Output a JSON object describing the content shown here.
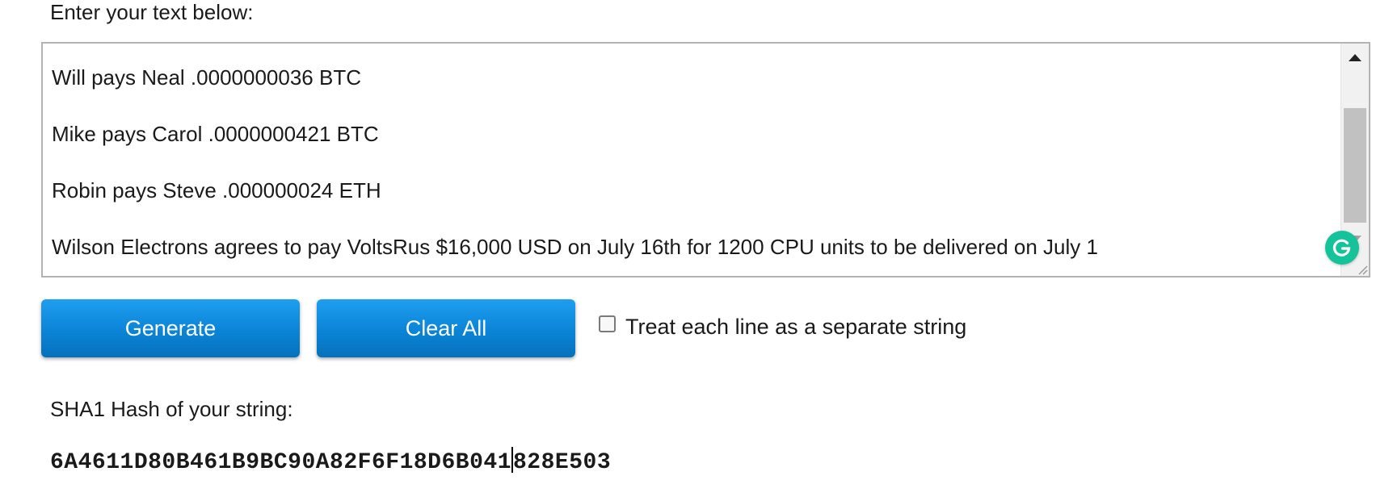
{
  "prompt_label": "Enter your text below:",
  "textarea": {
    "lines": [
      "Will pays Neal .0000000036 BTC",
      "Mike pays Carol .0000000421 BTC",
      "Robin pays Steve .000000024 ETH",
      "Wilson Electrons agrees to pay VoltsRus $16,000 USD on July 16th for 1200 CPU units to be delivered on July 1"
    ]
  },
  "buttons": {
    "generate_label": "Generate",
    "clear_label": "Clear All"
  },
  "checkbox": {
    "label": "Treat each line as a separate string",
    "checked": false
  },
  "hash": {
    "label": "SHA1 Hash of your string:",
    "value_part1": "6A4611D80B461B9BC90A82F6F18D6B041",
    "value_part2": "828E503"
  },
  "colors": {
    "button_blue": "#0a84d6",
    "grammarly_green": "#15c39a"
  },
  "icons": {
    "grammarly": "grammarly-g-icon",
    "resize": "resize-grip-icon"
  }
}
